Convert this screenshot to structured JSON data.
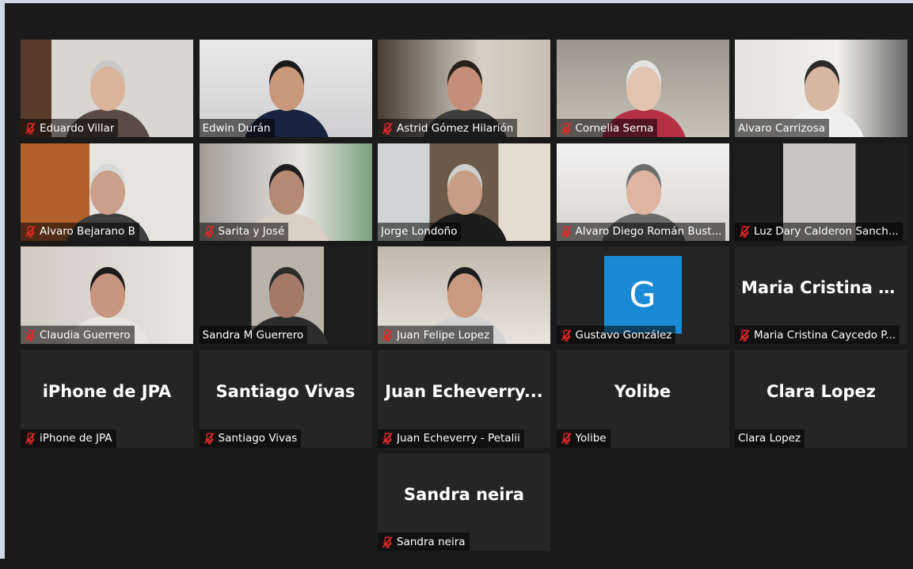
{
  "participants": [
    {
      "name": "Eduardo Villar",
      "muted": true,
      "video": true
    },
    {
      "name": "Edwin Durán",
      "muted": false,
      "video": true
    },
    {
      "name": "Astrid Gómez Hilarión",
      "muted": true,
      "video": true
    },
    {
      "name": "Cornelia Serna",
      "muted": true,
      "video": true
    },
    {
      "name": "Alvaro Carrizosa",
      "muted": false,
      "video": true
    },
    {
      "name": "Alvaro Bejarano B",
      "muted": true,
      "video": true
    },
    {
      "name": "Sarita y José",
      "muted": true,
      "video": true
    },
    {
      "name": "Jorge Londoño",
      "muted": false,
      "video": true
    },
    {
      "name": "Alvaro Diego Román Bust...",
      "muted": true,
      "video": true
    },
    {
      "name": "Luz Dary Calderon Sanch...",
      "muted": true,
      "video": true
    },
    {
      "name": "Claudia Guerrero",
      "muted": true,
      "video": true
    },
    {
      "name": "Sandra M Guerrero",
      "muted": false,
      "video": true,
      "active_speaker": true
    },
    {
      "name": "Juan Felipe Lopez",
      "muted": true,
      "video": true
    },
    {
      "name": "Gustavo González",
      "muted": true,
      "video": false,
      "avatar_letter": "G"
    },
    {
      "name": "Maria Cristina Caycedo P...",
      "muted": true,
      "video": false,
      "display_name": "Maria  Cristina  C..."
    },
    {
      "name": "iPhone de JPA",
      "muted": true,
      "video": false,
      "display_name": "iPhone de JPA"
    },
    {
      "name": "Santiago Vivas",
      "muted": true,
      "video": false,
      "display_name": "Santiago Vivas"
    },
    {
      "name": "Juan Echeverry - Petalii",
      "muted": true,
      "video": false,
      "display_name": "Juan  Echeverry..."
    },
    {
      "name": "Yolibe",
      "muted": true,
      "video": false,
      "display_name": "Yolibe"
    },
    {
      "name": "Clara Lopez",
      "muted": false,
      "video": false,
      "display_name": "Clara Lopez"
    },
    {
      "name": "Sandra neira",
      "muted": true,
      "video": false,
      "display_name": "Sandra neira"
    }
  ],
  "colors": {
    "background": "#1a1a1a",
    "tile": "#252525",
    "active_border": "#c9e06d",
    "muted_icon": "#e02828",
    "avatar": "#1b8ad6"
  },
  "icons": {
    "muted": "microphone-muted-icon"
  }
}
